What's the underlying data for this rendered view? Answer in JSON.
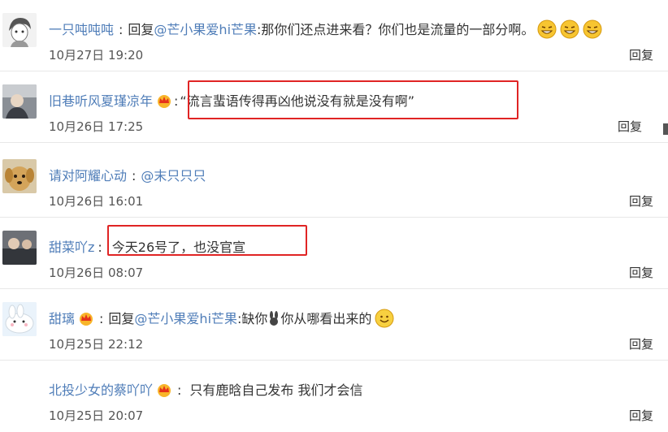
{
  "comments": [
    {
      "user": "一只吨吨吨",
      "prefix": "回复",
      "mention": "@芒小果爱hi芒果",
      "text": ":那你们还点进来看？你们也是流量的一部分啊。",
      "time": "10月27日 19:20",
      "reply": "回复",
      "emoji": "grin-emoji"
    },
    {
      "user": "旧巷听风夏瑾凉年",
      "text": "“流言蜚语传得再凶他说没有就是没有啊”",
      "time": "10月26日 17:25",
      "reply": "回复",
      "badge": "crown-icon"
    },
    {
      "user": "请对阿耀心动",
      "mention": "@末只只只",
      "time": "10月26日 16:01",
      "reply": "回复"
    },
    {
      "user": "甜菜吖z",
      "text": "今天26号了，也没官宣",
      "time": "10月26日 08:07",
      "reply": "回复"
    },
    {
      "user": "甜璃",
      "prefix": "回复",
      "mention": "@芒小果爱hi芒果",
      "text": ":缺你",
      "text2": "你从哪看出来的",
      "time": "10月25日 22:12",
      "reply": "回复",
      "badge": "crown-icon"
    },
    {
      "user": "北投少女的蔡吖吖",
      "text": "只有鹿晗自己发布 我们才会信",
      "time": "10月25日 20:07",
      "reply": "回复",
      "badge": "crown-icon"
    }
  ],
  "colors": {
    "username": "#4f7db8",
    "highlight": "#e02424",
    "text": "#333333"
  }
}
